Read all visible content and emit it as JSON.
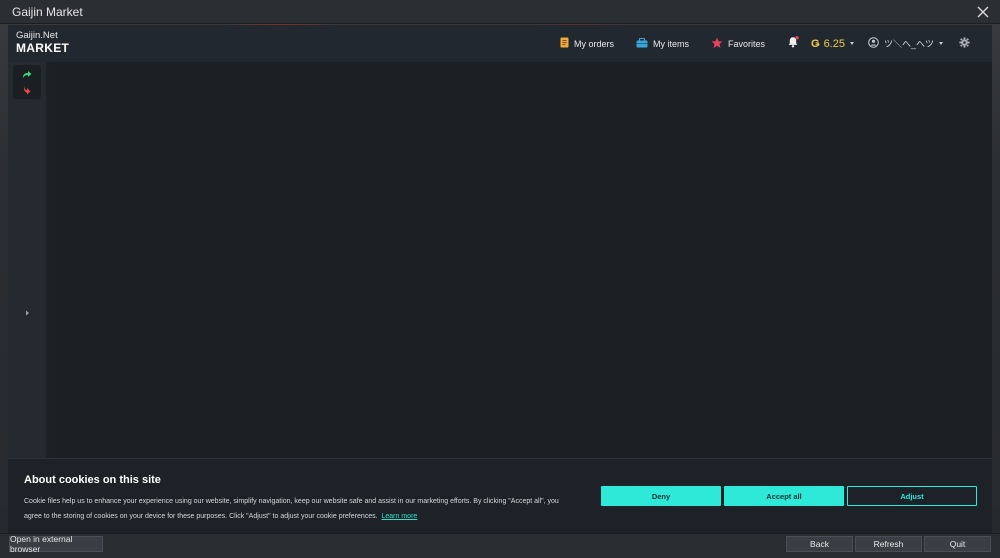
{
  "window": {
    "title": "Gaijin Market"
  },
  "header": {
    "logo_line1": "Gaijin.Net",
    "logo_line2": "MARKET",
    "nav": {
      "orders": "My orders",
      "items": "My items",
      "favorites": "Favorites"
    },
    "balance": {
      "currency_symbol": "Ǥ",
      "amount": "6.25"
    },
    "user": {
      "name": "ツ＼へ_へツ"
    }
  },
  "colors": {
    "accent": "#2ee8d8",
    "balance": "#f2c84b",
    "favorites_star": "#e8435d",
    "orders_icon": "#f2a93b",
    "items_icon": "#3aa6d8",
    "arrow_up": "#3ad37a",
    "arrow_down": "#e84848",
    "notification_dot": "#e84848"
  },
  "icons": [
    "close-icon",
    "orders-icon",
    "items-icon",
    "star-icon",
    "bell-icon",
    "gear-icon",
    "user-icon",
    "arrow-up-icon",
    "arrow-down-icon",
    "chevron-right-icon"
  ],
  "cookie": {
    "title": "About cookies on this site",
    "text_line1": "Cookie files help us to enhance your experience using our website, simplify navigation, keep our website safe and assist in our marketing efforts. By clicking \"Accept all\", you",
    "text_line2": "agree to the storing of cookies on your device for these purposes. Click \"Adjust\" to adjust your cookie preferences.",
    "learn_more": "Learn more",
    "deny": "Deny",
    "accept_all": "Accept all",
    "adjust": "Adjust"
  },
  "bottombar": {
    "open_external": "Open in external browser",
    "back": "Back",
    "refresh": "Refresh",
    "quit": "Quit"
  }
}
